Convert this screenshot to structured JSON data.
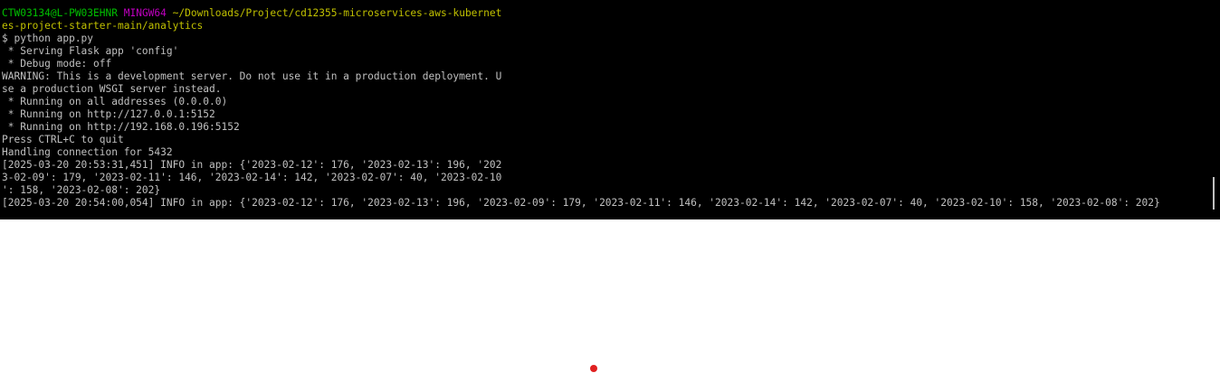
{
  "prompt": {
    "user_host": "CTW03134@L-PW03EHNR",
    "shell": "MINGW64",
    "path_part1": "~/Downloads/Project/cd12355-microservices-aws-kubernet",
    "path_part2": "es-project-starter-main/analytics"
  },
  "output_lines": [
    "$ python app.py",
    " * Serving Flask app 'config'",
    " * Debug mode: off",
    "WARNING: This is a development server. Do not use it in a production deployment. U",
    "se a production WSGI server instead.",
    " * Running on all addresses (0.0.0.0)",
    " * Running on http://127.0.0.1:5152",
    " * Running on http://192.168.0.196:5152",
    "Press CTRL+C to quit",
    "Handling connection for 5432",
    "[2025-03-20 20:53:31,451] INFO in app: {'2023-02-12': 176, '2023-02-13': 196, '202",
    "3-02-09': 179, '2023-02-11': 146, '2023-02-14': 142, '2023-02-07': 40, '2023-02-10",
    "': 158, '2023-02-08': 202}",
    "[2025-03-20 20:54:00,054] INFO in app: {'2023-02-12': 176, '2023-02-13': 196, '2023-02-09': 179, '2023-02-11': 146, '2023-02-14': 142, '2023-02-07': 40, '2023-02-10': 158, '2023-02-08': 202}"
  ],
  "colors": {
    "background": "#000000",
    "text": "#c0c0c0",
    "user_host": "#00c000",
    "shell": "#c000c0",
    "path": "#c0c000",
    "cursor_dot": "#e02020"
  }
}
